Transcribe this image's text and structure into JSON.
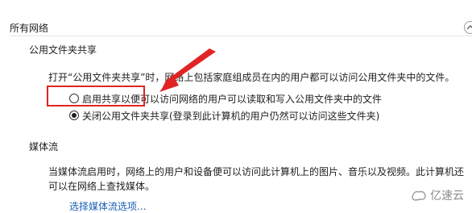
{
  "section": {
    "title": "所有网络"
  },
  "public_folder": {
    "title": "公用文件夹共享",
    "description": "打开“公用文件夹共享”时，网络上包括家庭组成员在内的用户都可以访问公用文件夹中的文件。",
    "options": [
      {
        "label": "启用共享以便可以访问网络的用户可以读取和写入公用文件夹中的文件",
        "selected": false
      },
      {
        "label": "关闭公用文件夹共享(登录到此计算机的用户仍然可以访问这些文件夹)",
        "selected": true
      }
    ]
  },
  "media": {
    "title": "媒体流",
    "description_line1": "当媒体流启用时，网络上的用户和设备便可以访问此计算机上的图片、音乐以及视频。此计算机还",
    "description_line2": "可以在网络上查找媒体。",
    "link": "选择媒体流选项..."
  },
  "watermark": {
    "text": "亿速云"
  },
  "colors": {
    "annotation": "#e02424",
    "link": "#1a5fb4"
  }
}
